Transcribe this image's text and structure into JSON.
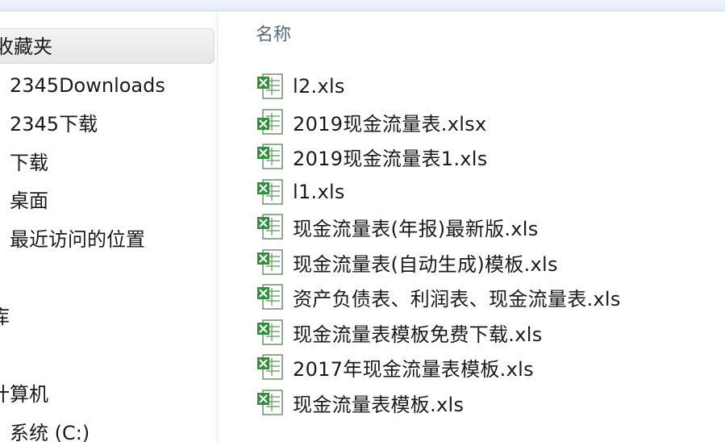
{
  "navigation": {
    "favorites_label": "收藏夹",
    "favorites_items": [
      {
        "label": "2345Downloads"
      },
      {
        "label": "2345下载"
      },
      {
        "label": "下载"
      },
      {
        "label": "桌面"
      },
      {
        "label": "最近访问的位置"
      }
    ],
    "libraries_label": "库",
    "computer_label": "计算机",
    "computer_items": [
      {
        "label": "系统 (C:)"
      }
    ]
  },
  "file_list": {
    "column_header": "名称",
    "files": [
      {
        "name": "l2.xls",
        "icon": "excel-file-icon"
      },
      {
        "name": "2019现金流量表.xlsx",
        "icon": "excel-xlsx-file-icon"
      },
      {
        "name": "2019现金流量表1.xls",
        "icon": "excel-file-icon"
      },
      {
        "name": "l1.xls",
        "icon": "excel-file-icon"
      },
      {
        "name": "现金流量表(年报)最新版.xls",
        "icon": "excel-file-icon"
      },
      {
        "name": "现金流量表(自动生成)模板.xls",
        "icon": "excel-file-icon"
      },
      {
        "name": "资产负债表、利润表、现金流量表.xls",
        "icon": "excel-file-icon"
      },
      {
        "name": "现金流量表模板免费下载.xls",
        "icon": "excel-file-icon"
      },
      {
        "name": "2017年现金流量表模板.xls",
        "icon": "excel-file-icon"
      },
      {
        "name": "现金流量表模板.xls",
        "icon": "excel-file-icon"
      }
    ]
  },
  "colors": {
    "excel_green": "#2f8f3a",
    "selection_bg": "#e9e9e9",
    "header_text": "#5a6a7a"
  }
}
